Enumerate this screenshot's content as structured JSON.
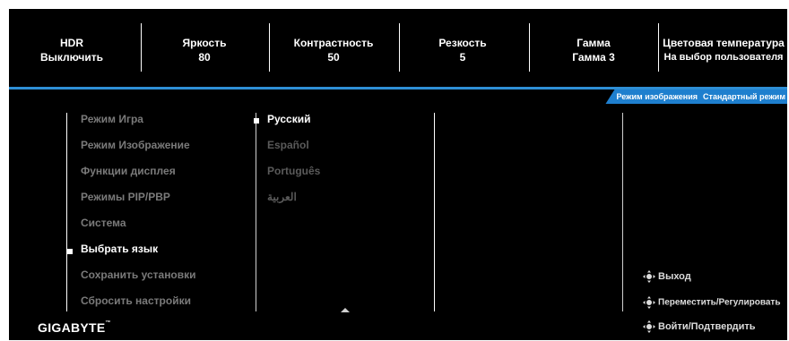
{
  "status_bar": [
    {
      "label": "HDR",
      "value": "Выключить"
    },
    {
      "label": "Яркость",
      "value": "80"
    },
    {
      "label": "Контрастность",
      "value": "50"
    },
    {
      "label": "Резкость",
      "value": "5"
    },
    {
      "label": "Гамма",
      "value": "Гамма 3"
    },
    {
      "label": "Цветовая температура",
      "value": "На выбор пользователя"
    }
  ],
  "mode_tag": {
    "label": "Режим изображения",
    "value": "Стандартный режим"
  },
  "menu": {
    "items": [
      "Режим Игра",
      "Режим Изображение",
      "Функции дисплея",
      "Режимы PIP/PBP",
      "Система",
      "Выбрать язык",
      "Сохранить установки",
      "Сбросить настройки"
    ],
    "selected": "Выбрать язык"
  },
  "languages": {
    "items": [
      "Русский",
      "Español",
      "Português",
      "العربية"
    ],
    "selected": "Русский"
  },
  "logo": "GIGABYTE",
  "hints": [
    {
      "icon": "joystick-icon",
      "label": "Выход"
    },
    {
      "icon": "joystick-icon",
      "label": "Переместить/Регулировать"
    },
    {
      "icon": "joystick-icon",
      "label": "Войти/Подтвердить"
    }
  ],
  "colors": {
    "background": "#000000",
    "accent": "#1e7fce",
    "text": "#ffffff",
    "dim_text": "#7a7a7a"
  }
}
